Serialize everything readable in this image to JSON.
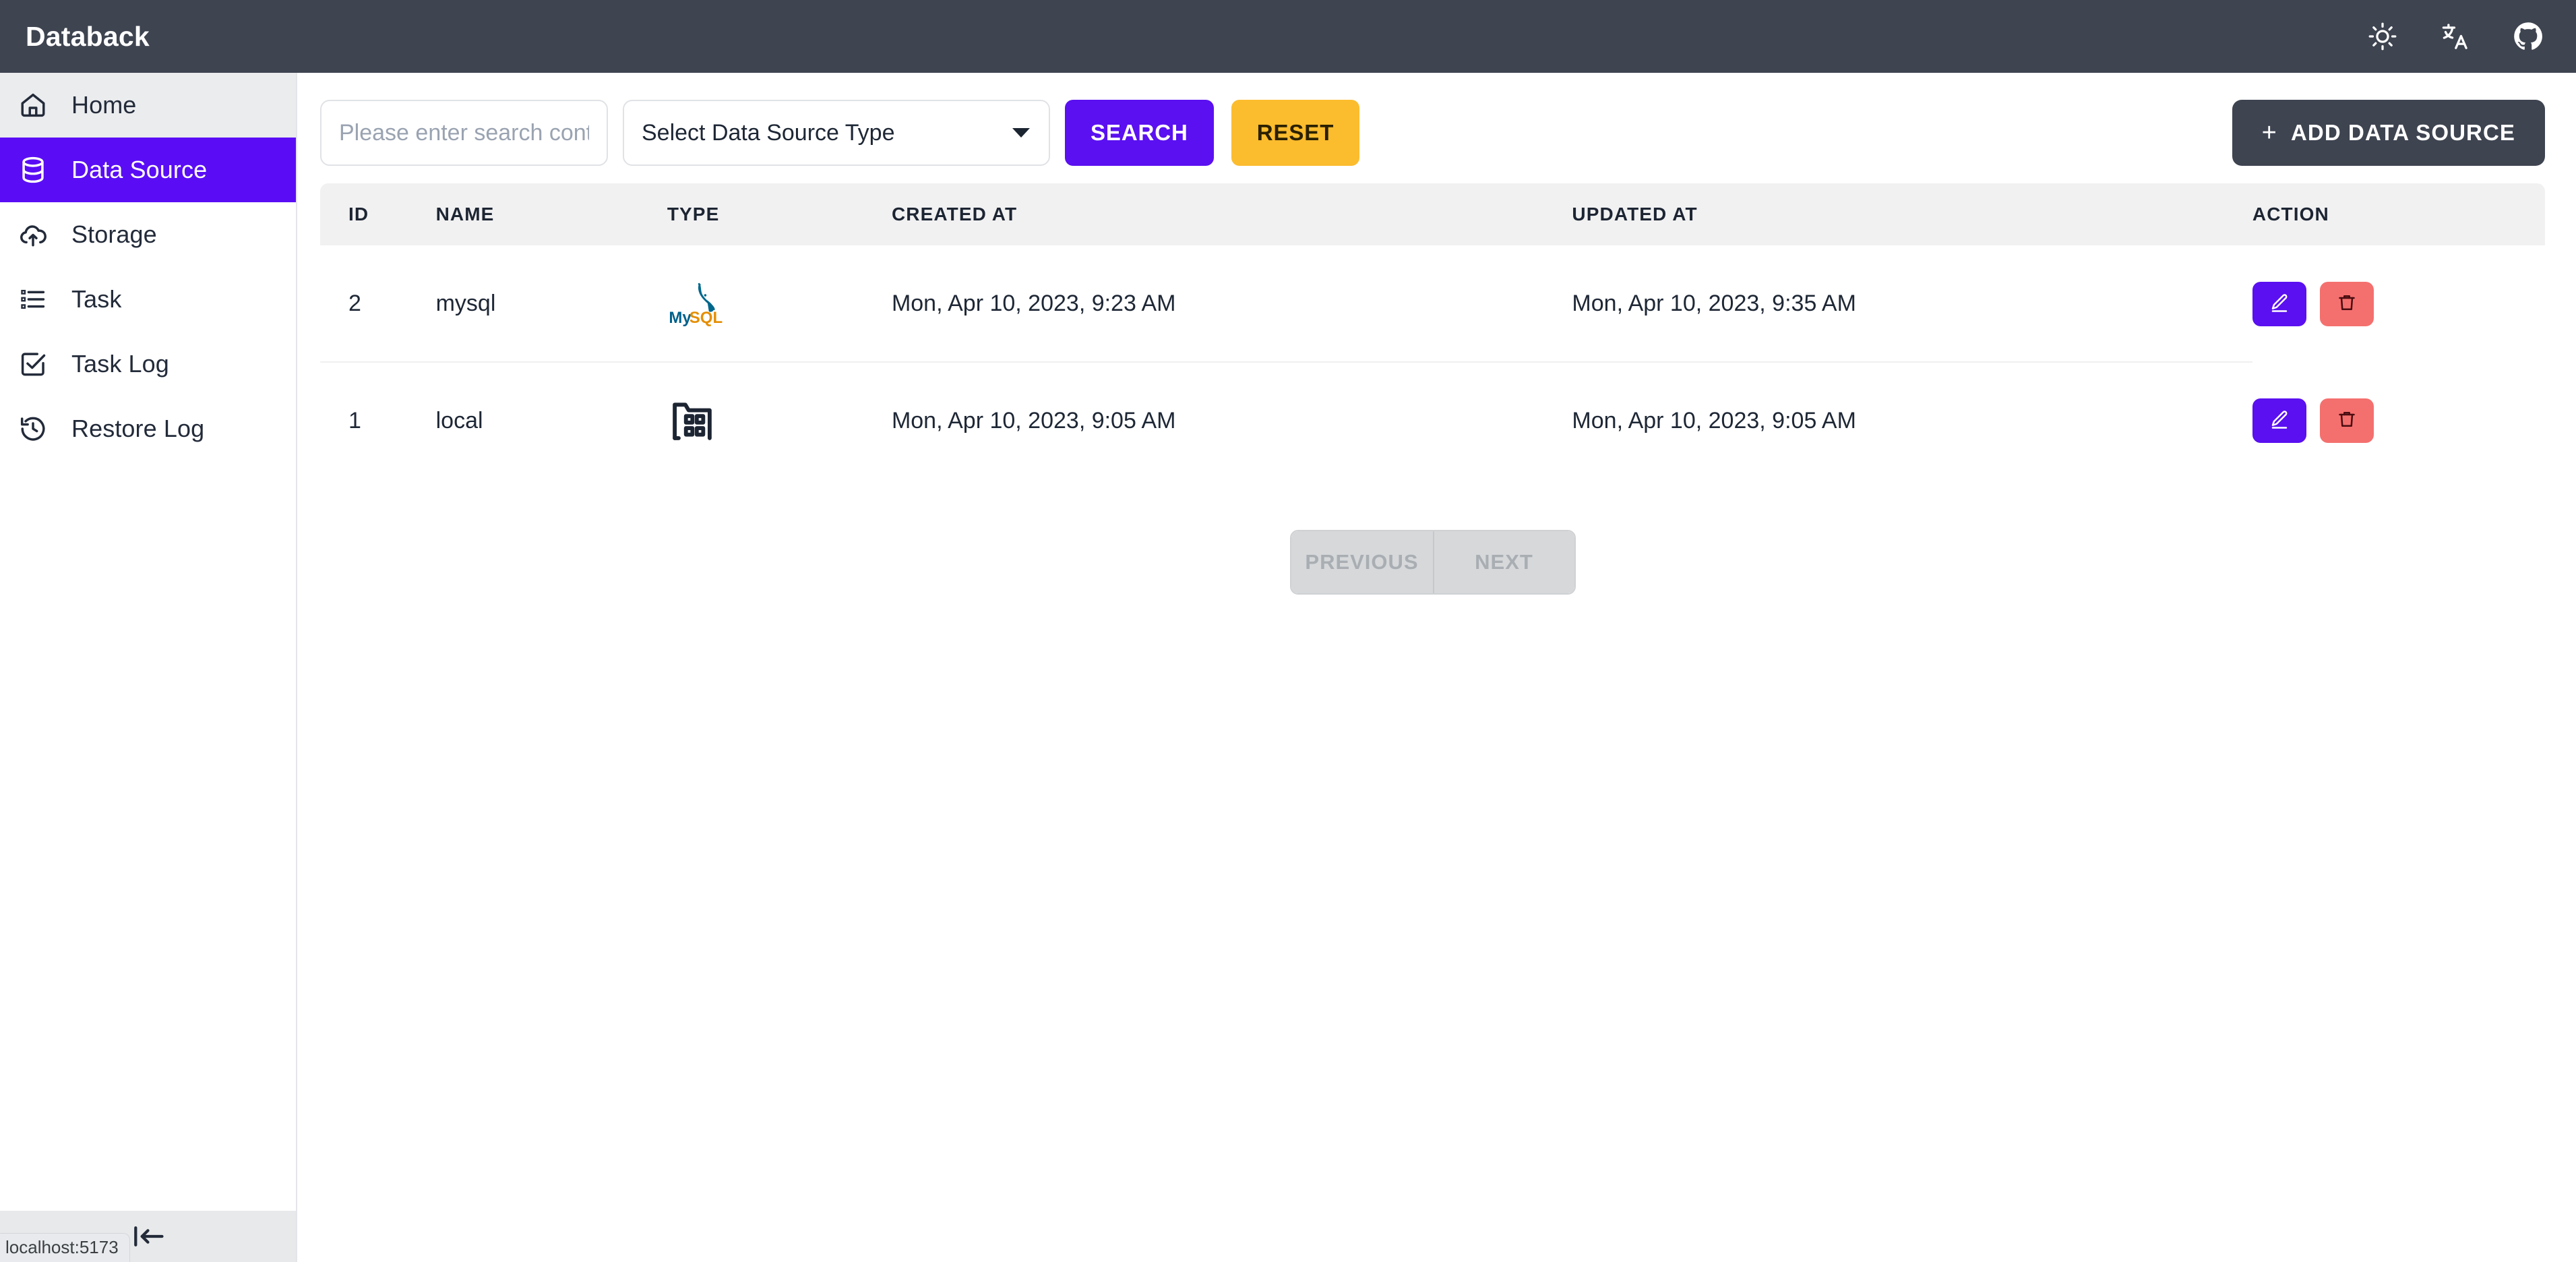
{
  "header": {
    "title": "Databack",
    "icons": [
      {
        "name": "theme-toggle-icon",
        "label": "sun-icon"
      },
      {
        "name": "language-icon",
        "label": "translate-icon"
      },
      {
        "name": "github-icon",
        "label": "github-icon"
      }
    ]
  },
  "sidebar": {
    "items": [
      {
        "label": "Home",
        "icon": "home-icon",
        "state": "hovered"
      },
      {
        "label": "Data Source",
        "icon": "database-icon",
        "state": "active"
      },
      {
        "label": "Storage",
        "icon": "cloud-upload-icon",
        "state": "normal"
      },
      {
        "label": "Task",
        "icon": "list-icon",
        "state": "normal"
      },
      {
        "label": "Task Log",
        "icon": "check-square-icon",
        "state": "normal"
      },
      {
        "label": "Restore Log",
        "icon": "history-icon",
        "state": "normal"
      }
    ],
    "collapse_icon": "collapse-left-icon"
  },
  "statusbar": {
    "url": "localhost:5173"
  },
  "toolbar": {
    "search_placeholder": "Please enter search content",
    "search_value": "",
    "select_label": "Select Data Source Type",
    "search_button": "SEARCH",
    "reset_button": "RESET",
    "add_button": "ADD DATA SOURCE",
    "add_button_plus": "+"
  },
  "table": {
    "columns": [
      "ID",
      "NAME",
      "TYPE",
      "CREATED AT",
      "UPDATED AT",
      "ACTION"
    ],
    "rows": [
      {
        "id": "2",
        "name": "mysql",
        "type_icon": "mysql-logo",
        "created_at": "Mon, Apr 10, 2023, 9:23 AM",
        "updated_at": "Mon, Apr 10, 2023, 9:35 AM"
      },
      {
        "id": "1",
        "name": "local",
        "type_icon": "local-folder-icon",
        "created_at": "Mon, Apr 10, 2023, 9:05 AM",
        "updated_at": "Mon, Apr 10, 2023, 9:05 AM"
      }
    ],
    "row_actions": {
      "edit_icon": "pencil-icon",
      "delete_icon": "trash-icon"
    }
  },
  "pagination": {
    "previous": "PREVIOUS",
    "next": "NEXT",
    "previous_disabled": true,
    "next_disabled": true
  },
  "colors": {
    "header_bg": "#3e4450",
    "accent_purple": "#5a0df5",
    "reset_amber": "#fbbc2e",
    "delete_red": "#f4706e",
    "table_header_bg": "#f1f1f2"
  }
}
